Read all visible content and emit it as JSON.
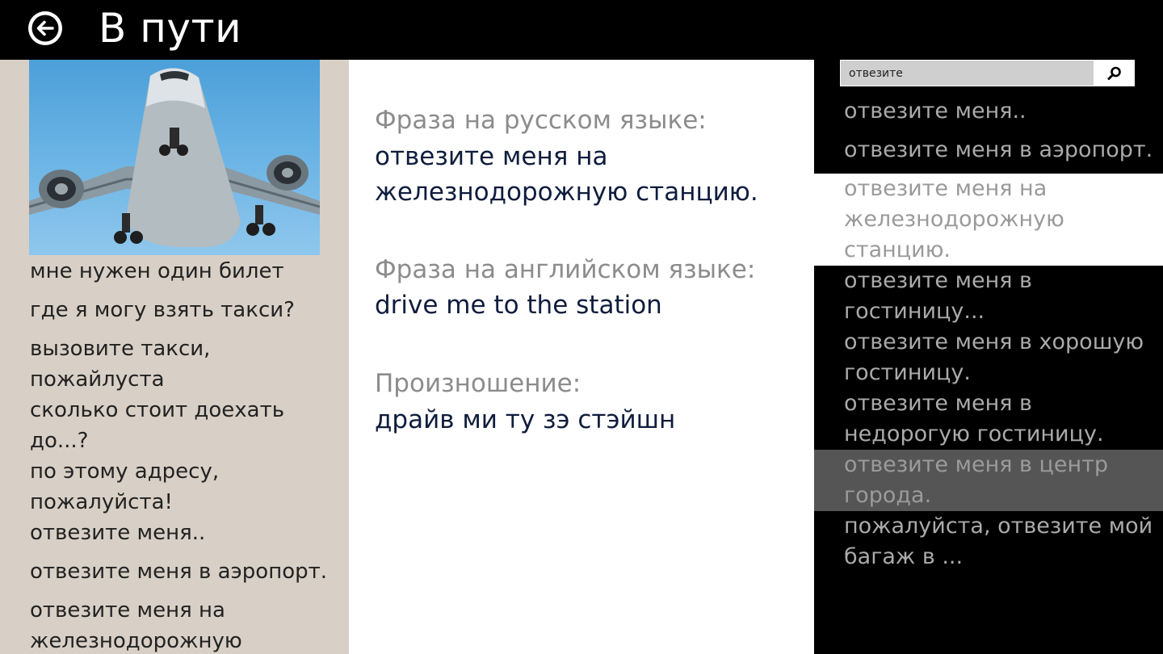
{
  "header": {
    "title": "В пути"
  },
  "left": {
    "phrases": [
      "мне нужен один билет",
      "где я могу взять такси?",
      "вызовите такси, пожайлуста",
      "сколько стоит доехать до...?",
      "по этому адресу, пожалуйста!",
      "отвезите меня..",
      "отвезите меня в аэропорт.",
      "отвезите меня на железнодорожную"
    ]
  },
  "detail": {
    "ru_label": "Фраза на русском языке:",
    "ru_value": "отвезите меня на железнодорожную станцию.",
    "en_label": "Фраза на английском языке:",
    "en_value": "drive me to the station",
    "pron_label": "Произношение:",
    "pron_value": "драйв ми ту зэ стэйшн"
  },
  "search": {
    "query": "отвезите",
    "results": [
      "отвезите меня..",
      "отвезите меня в аэропорт.",
      "отвезите меня на железнодорожную станцию.",
      "отвезите меня в гостиницу...",
      "отвезите меня в хорошую гостиницу.",
      "отвезите меня в недорогую гостиницу.",
      "отвезите меня в центр города.",
      "пожалуйста, отвезите мой багаж в ..."
    ],
    "selected_index": 2,
    "hover_index": 6
  },
  "icons": {
    "back": "back-arrow-icon",
    "search": "search-icon",
    "photo": "airplane-photo"
  },
  "colors": {
    "left_panel_bg": "#d8d0c6",
    "value_text": "#0f1d3d",
    "label_text": "#8c8c8c",
    "sky": "#4c9fd9"
  }
}
